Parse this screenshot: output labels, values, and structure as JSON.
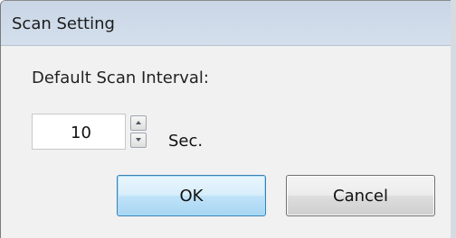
{
  "dialog": {
    "title": "Scan Setting",
    "interval_label": "Default Scan Interval:",
    "interval_value": "10",
    "interval_unit": "Sec.",
    "ok_label": "OK",
    "cancel_label": "Cancel"
  },
  "icons": {
    "spin_up": "triangle-up-icon",
    "spin_down": "triangle-down-icon"
  },
  "colors": {
    "titlebar": "#c9d6e6",
    "ok_accent": "#3c7fb1"
  }
}
